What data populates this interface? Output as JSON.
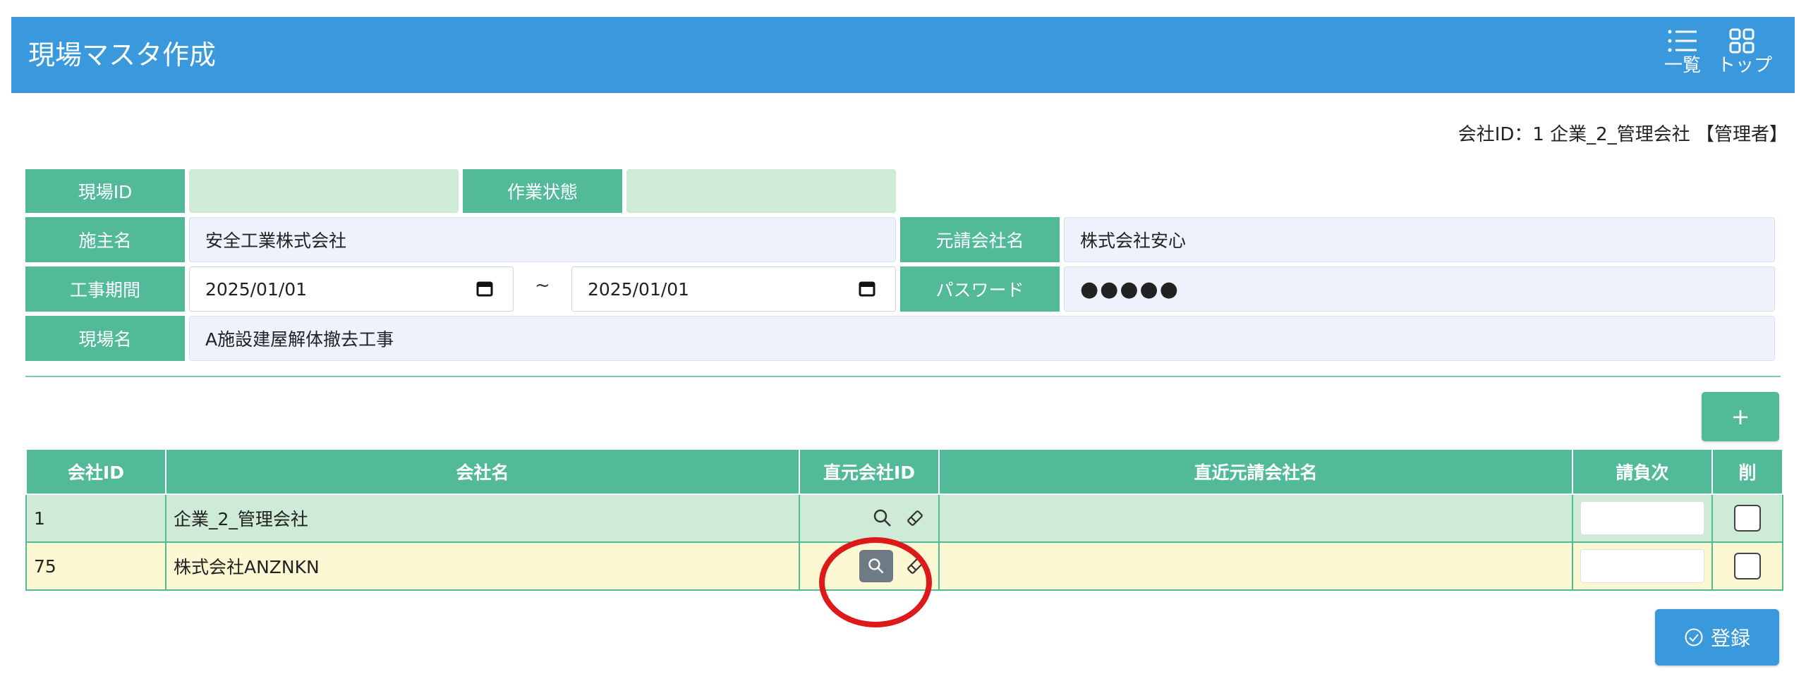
{
  "header": {
    "title": "現場マスタ作成",
    "list_label": "一覧",
    "top_label": "トップ"
  },
  "company_info": "会社ID：1 企業_2_管理会社 【管理者】",
  "form": {
    "site_id_label": "現場ID",
    "site_id_value": "",
    "work_status_label": "作業状態",
    "work_status_value": "",
    "client_label": "施主名",
    "client_value": "安全工業株式会社",
    "prime_contractor_label": "元請会社名",
    "prime_contractor_value": "株式会社安心",
    "period_label": "工事期間",
    "period_start": "2025/01/01",
    "period_sep": "~",
    "period_end": "2025/01/01",
    "password_label": "パスワード",
    "password_value": "●●●●●",
    "site_name_label": "現場名",
    "site_name_value": "A施設建屋解体撤去工事"
  },
  "add_button_label": "+",
  "table": {
    "columns": [
      "会社ID",
      "会社名",
      "直元会社ID",
      "直近元請会社名",
      "請負次",
      "削"
    ],
    "rows": [
      {
        "company_id": "1",
        "company_name": "企業_2_管理会社"
      },
      {
        "company_id": "75",
        "company_name": "株式会社ANZNKN"
      }
    ]
  },
  "register_label": "登録",
  "colors": {
    "header_blue": "#3a98dc",
    "label_green": "#52ba98",
    "row_green": "#cdebd7",
    "row_yellow": "#fcf8d3",
    "highlight_red": "#dc1a1a"
  }
}
